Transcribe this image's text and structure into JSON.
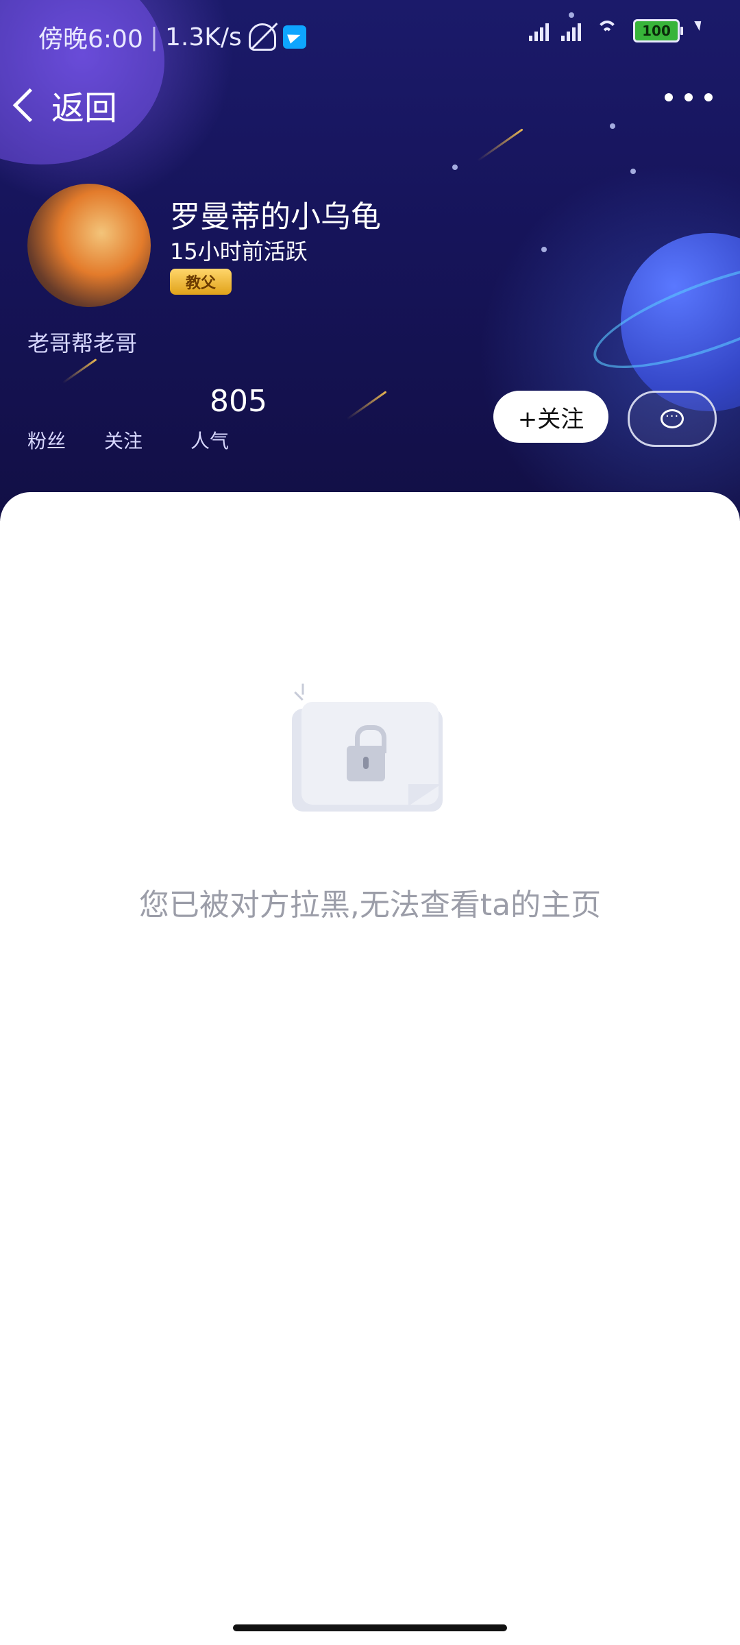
{
  "status_bar": {
    "time": "傍晚6:00",
    "speed": "1.3K/s",
    "battery": "100"
  },
  "nav": {
    "back_label": "返回"
  },
  "profile": {
    "username": "罗曼蒂的小乌龟",
    "active_text": "15小时前活跃",
    "badge": "教父",
    "signature": "老哥帮老哥"
  },
  "stats": {
    "popularity_value": "805",
    "fans_label": "粉丝",
    "following_label": "关注",
    "popularity_label": "人气"
  },
  "actions": {
    "follow_label": "+关注"
  },
  "message": {
    "blocked_text": "您已被对方拉黑,无法查看ta的主页"
  }
}
